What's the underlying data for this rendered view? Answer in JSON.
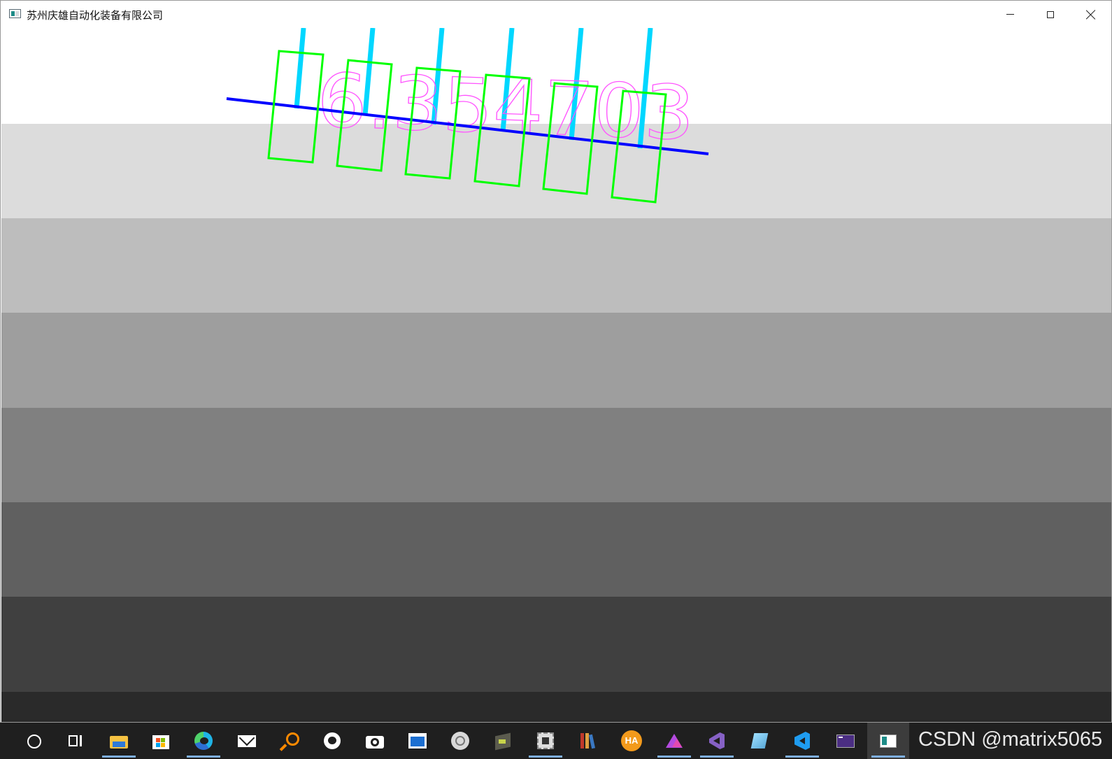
{
  "window": {
    "title": "苏州庆雄自动化装备有限公司",
    "controls": [
      "minimize",
      "maximize",
      "close"
    ]
  },
  "canvas": {
    "text_overlay": "6.354703",
    "band_colors": [
      "#ffffff",
      "#dcdcdc",
      "#bdbdbd",
      "#9e9e9e",
      "#808080",
      "#606060",
      "#404040",
      "#2a2a2a"
    ],
    "line_color": "#0000ff",
    "box_color": "#00ff00",
    "tick_color": "#00d7ff",
    "text_color": "#ff55ff"
  },
  "taskbar": {
    "icons": [
      "search-circle-icon",
      "task-view-icon",
      "file-explorer-icon",
      "store-icon",
      "edge-icon",
      "mail-icon",
      "search-tool-icon",
      "github-icon",
      "camera-icon",
      "window-app-icon",
      "settings-app-icon",
      "3d-box-icon",
      "chip-app-icon",
      "books-icon",
      "ha-icon",
      "triangle-app-icon",
      "visual-studio-icon",
      "notes-icon",
      "vscode-icon",
      "terminal-icon",
      "current-app-icon"
    ],
    "ha_label": "HA"
  },
  "watermark": "CSDN @matrix5065"
}
